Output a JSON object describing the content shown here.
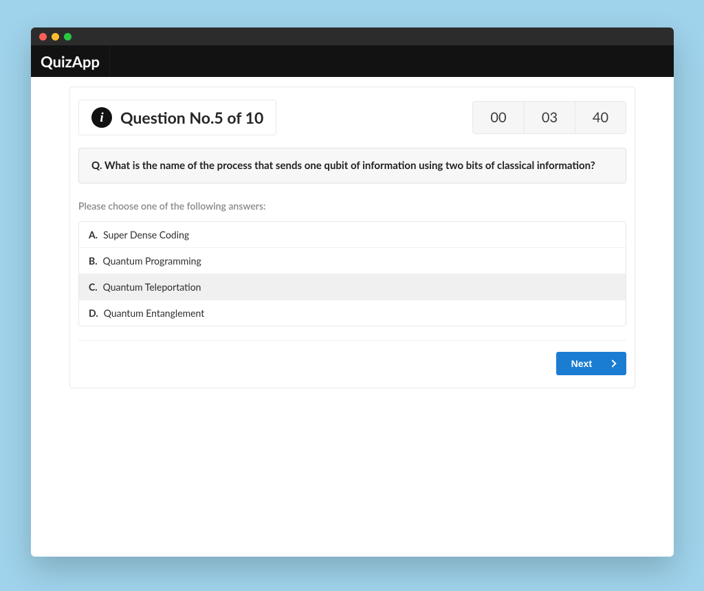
{
  "app": {
    "brand": "QuizApp"
  },
  "header": {
    "title": "Question No.5 of 10",
    "timer": {
      "hh": "00",
      "mm": "03",
      "ss": "40"
    }
  },
  "question": {
    "prompt": "Q. What is the name of the process that sends one qubit of information using two bits of classical information?",
    "hint": "Please choose one of the following answers:",
    "options": [
      {
        "letter": "A.",
        "text": "Super Dense Coding"
      },
      {
        "letter": "B.",
        "text": "Quantum Programming"
      },
      {
        "letter": "C.",
        "text": "Quantum Teleportation"
      },
      {
        "letter": "D.",
        "text": "Quantum Entanglement"
      }
    ],
    "selected_index": 2
  },
  "actions": {
    "next_label": "Next"
  }
}
